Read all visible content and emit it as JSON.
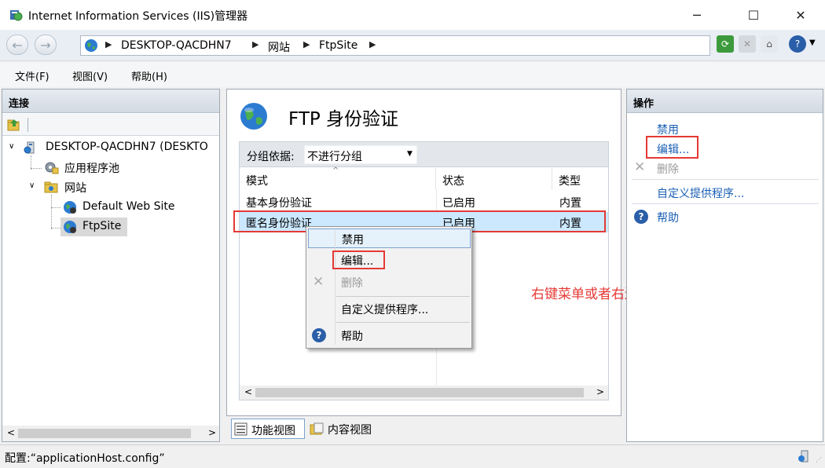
{
  "window": {
    "title": "Internet Information Services (IIS)管理器",
    "minimize": "─",
    "maximize": "☐",
    "close": "✕"
  },
  "address": {
    "back": "←",
    "forward": "→",
    "crumbs": [
      "DESKTOP-QACDHN7",
      "网站",
      "FtpSite"
    ]
  },
  "menubar": [
    "文件(F)",
    "视图(V)",
    "帮助(H)"
  ],
  "connections": {
    "title": "连接",
    "tree": {
      "server": "DESKTOP-QACDHN7 (DESKTO",
      "app_pools": "应用程序池",
      "sites": "网站",
      "default_site": "Default Web Site",
      "ftp_site": "FtpSite"
    }
  },
  "feature": {
    "title": "FTP 身份验证",
    "group_label": "分组依据:",
    "group_value": "不进行分组",
    "columns": [
      "模式",
      "状态",
      "类型"
    ],
    "rows": [
      [
        "基本身份验证",
        "已启用",
        "内置"
      ],
      [
        "匿名身份验证",
        "已启用",
        "内置"
      ]
    ]
  },
  "context_menu": {
    "items": [
      "禁用",
      "编辑...",
      "删除",
      "自定义提供程序...",
      "帮助"
    ]
  },
  "annotation": "右键菜单或者右边的编辑",
  "actions": {
    "title": "操作",
    "items": [
      "禁用",
      "编辑...",
      "删除",
      "自定义提供程序...",
      "帮助"
    ]
  },
  "views": {
    "features": "功能视图",
    "content": "内容视图"
  },
  "status": {
    "text": "配置:“applicationHost.config”"
  },
  "colors": {
    "selected_row": "#cce8ff",
    "annotation_red": "#e53935",
    "link_blue": "#1a5fb4"
  }
}
